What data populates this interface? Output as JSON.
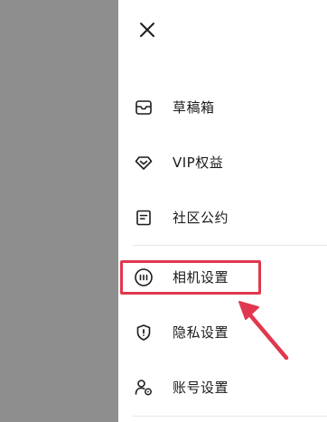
{
  "drawer": {
    "close_icon": "close-icon",
    "items": [
      {
        "label": "草稿箱",
        "icon": "inbox-tray-icon"
      },
      {
        "label": "VIP权益",
        "icon": "diamond-icon"
      },
      {
        "label": "社区公约",
        "icon": "document-icon"
      },
      {
        "label": "相机设置",
        "icon": "camera-settings-icon"
      },
      {
        "label": "隐私设置",
        "icon": "privacy-shield-icon"
      },
      {
        "label": "账号设置",
        "icon": "account-settings-icon"
      }
    ]
  },
  "annotation": {
    "highlight_color": "#e0384e"
  },
  "colors": {
    "overlay": "#8e8e8e",
    "drawer_bg": "#ffffff",
    "divider": "#e6e6e6"
  }
}
